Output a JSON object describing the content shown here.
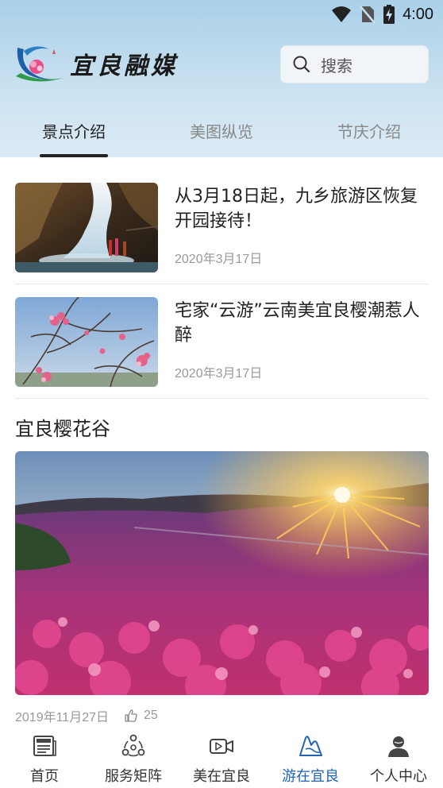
{
  "status_bar": {
    "time": "4:00",
    "icons": [
      "wifi-icon",
      "no-sim-icon",
      "battery-charging-icon"
    ]
  },
  "header": {
    "logo_text": "宜良融媒",
    "search_placeholder": "搜索",
    "tabs": [
      {
        "label": "景点介绍",
        "active": true
      },
      {
        "label": "美图纵览",
        "active": false
      },
      {
        "label": "节庆介绍",
        "active": false
      }
    ]
  },
  "news": [
    {
      "title": "从3月18日起，九乡旅游区恢复开园接待！",
      "date": "2020年3月17日",
      "thumb": "waterfall-cave-photo"
    },
    {
      "title": "宅家“云游”云南美宜良樱潮惹人醉",
      "date": "2020年3月17日",
      "thumb": "cherry-blossom-branch-photo"
    }
  ],
  "featured": {
    "title": "宜良樱花谷",
    "image": "cherry-valley-sunset-photo",
    "date": "2019年11月27日",
    "likes": "25"
  },
  "bottom_nav": [
    {
      "label": "首页",
      "icon": "newspaper-icon",
      "active": false
    },
    {
      "label": "服务矩阵",
      "icon": "network-icon",
      "active": false
    },
    {
      "label": "美在宜良",
      "icon": "video-icon",
      "active": false
    },
    {
      "label": "游在宜良",
      "icon": "mountain-icon",
      "active": true
    },
    {
      "label": "个人中心",
      "icon": "user-icon",
      "active": false
    }
  ],
  "colors": {
    "accent": "#1e63b8",
    "header_bg": "#c9e1f0"
  }
}
